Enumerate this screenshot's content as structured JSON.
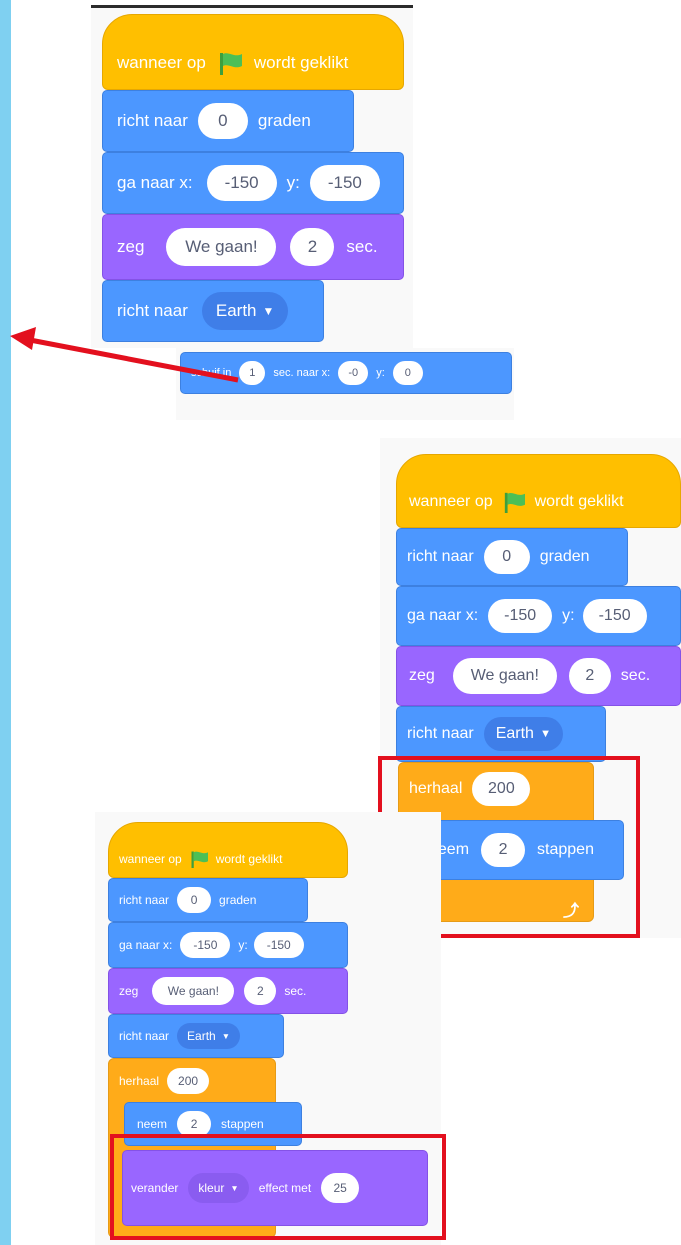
{
  "script1": {
    "hat": {
      "pre": "wanneer op",
      "post": "wordt geklikt"
    },
    "point_dir": {
      "label": "richt naar",
      "value": "0",
      "post": "graden"
    },
    "goto": {
      "label": "ga naar x:",
      "x": "-150",
      "ylabel": "y:",
      "y": "-150"
    },
    "say": {
      "label": "zeg",
      "text": "We gaan!",
      "secs": "2",
      "post": "sec."
    },
    "point_towards": {
      "label": "richt naar",
      "target": "Earth"
    },
    "glide": {
      "label": "schuif in",
      "secs": "1",
      "mid": "sec. naar x:",
      "x": "-0",
      "ylabel": "y:",
      "y": "0"
    }
  },
  "script2": {
    "hat": {
      "pre": "wanneer op",
      "post": "wordt geklikt"
    },
    "point_dir": {
      "label": "richt naar",
      "value": "0",
      "post": "graden"
    },
    "goto": {
      "label": "ga naar x:",
      "x": "-150",
      "ylabel": "y:",
      "y": "-150"
    },
    "say": {
      "label": "zeg",
      "text": "We gaan!",
      "secs": "2",
      "post": "sec."
    },
    "point_towards": {
      "label": "richt naar",
      "target": "Earth"
    },
    "repeat": {
      "label": "herhaal",
      "count": "200"
    },
    "move": {
      "label": "neem",
      "steps": "2",
      "post": "stappen"
    },
    "loop_arrow": "⤴"
  },
  "script3": {
    "hat": {
      "pre": "wanneer op",
      "post": "wordt geklikt"
    },
    "point_dir": {
      "label": "richt naar",
      "value": "0",
      "post": "graden"
    },
    "goto": {
      "label": "ga naar x:",
      "x": "-150",
      "ylabel": "y:",
      "y": "-150"
    },
    "say": {
      "label": "zeg",
      "text": "We gaan!",
      "secs": "2",
      "post": "sec."
    },
    "point_towards": {
      "label": "richt naar",
      "target": "Earth"
    },
    "repeat": {
      "label": "herhaal",
      "count": "200"
    },
    "move": {
      "label": "neem",
      "steps": "2",
      "post": "stappen"
    },
    "change_effect": {
      "label": "verander",
      "effect": "kleur",
      "post": "effect met",
      "value": "25"
    }
  },
  "colors": {
    "events": "#ffbf00",
    "motion": "#4c97ff",
    "looks": "#9966ff",
    "control": "#ffab19",
    "highlight": "#e3101e",
    "sidebar": "#7fd0f1"
  },
  "icons": {
    "flag": "green-flag-icon",
    "arrow": "red-arrow-icon",
    "caret": "dropdown-caret-icon"
  }
}
